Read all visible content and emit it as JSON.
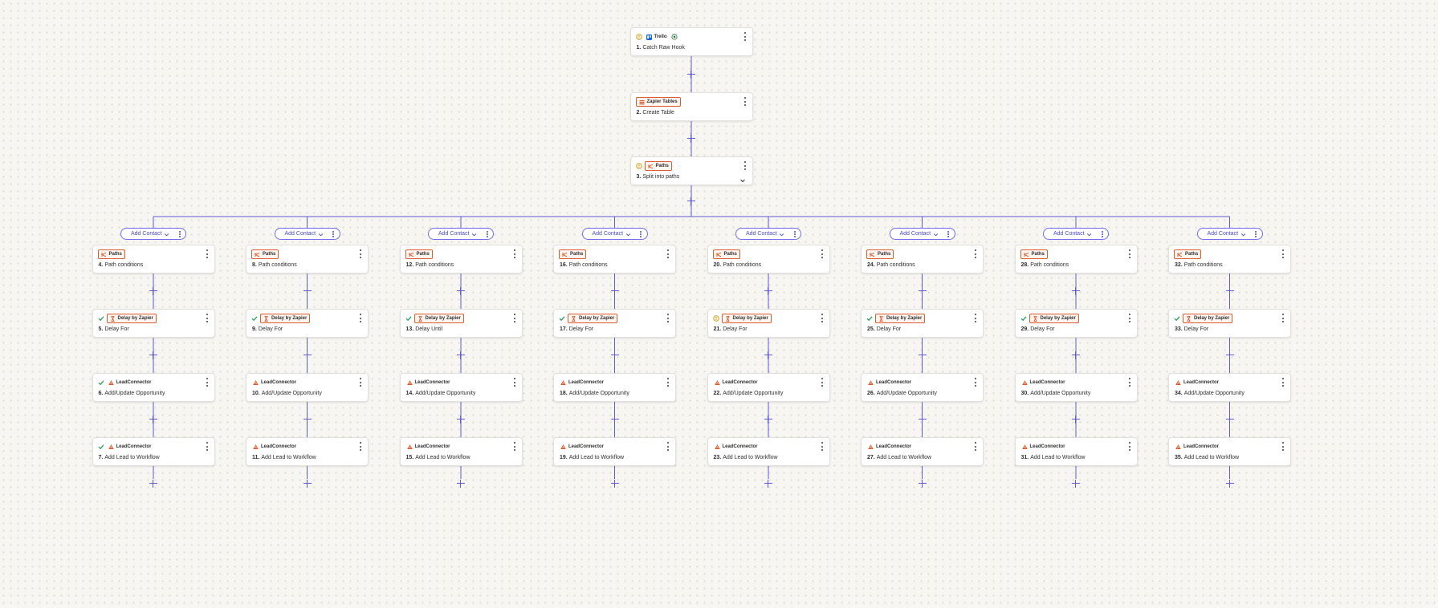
{
  "colors": {
    "accent": "#5d5bd4",
    "brand_orange": "#e0592a",
    "success": "#1f9d55",
    "warning": "#c79a18",
    "trello": "#0c66e4"
  },
  "top_steps": [
    {
      "num": "1.",
      "title": "Catch Raw Hook",
      "app": "Trello",
      "app_icon": "trello-icon",
      "badge_style": "plain",
      "status": "warning",
      "extra_icon": "settings-badge-icon",
      "chevron": false
    },
    {
      "num": "2.",
      "title": "Create Table",
      "app": "Zapier Tables",
      "app_icon": "zapier-tables-icon",
      "badge_style": "orange",
      "status": "none",
      "extra_icon": "",
      "chevron": false
    },
    {
      "num": "3.",
      "title": "Split into paths",
      "app": "Paths",
      "app_icon": "paths-icon",
      "badge_style": "orange",
      "status": "warning",
      "extra_icon": "",
      "chevron": true
    }
  ],
  "branches": [
    {
      "label": "Add Contact",
      "steps": [
        {
          "num": "4.",
          "title": "Path conditions",
          "app": "Paths",
          "status": "none"
        },
        {
          "num": "5.",
          "title": "Delay For",
          "app": "Delay by Zapier",
          "status": "success"
        },
        {
          "num": "6.",
          "title": "Add/Update Opportunity",
          "app": "LeadConnector",
          "status": "success"
        },
        {
          "num": "7.",
          "title": "Add Lead to Workflow",
          "app": "LeadConnector",
          "status": "success"
        }
      ]
    },
    {
      "label": "Add Contact",
      "steps": [
        {
          "num": "8.",
          "title": "Path conditions",
          "app": "Paths",
          "status": "none"
        },
        {
          "num": "9.",
          "title": "Delay For",
          "app": "Delay by Zapier",
          "status": "success"
        },
        {
          "num": "10.",
          "title": "Add/Update Opportunity",
          "app": "LeadConnector",
          "status": "none"
        },
        {
          "num": "11.",
          "title": "Add Lead to Workflow",
          "app": "LeadConnector",
          "status": "none"
        }
      ]
    },
    {
      "label": "Add Contact",
      "steps": [
        {
          "num": "12.",
          "title": "Path conditions",
          "app": "Paths",
          "status": "none"
        },
        {
          "num": "13.",
          "title": "Delay Until",
          "app": "Delay by Zapier",
          "status": "success"
        },
        {
          "num": "14.",
          "title": "Add/Update Opportunity",
          "app": "LeadConnector",
          "status": "none"
        },
        {
          "num": "15.",
          "title": "Add Lead to Workflow",
          "app": "LeadConnector",
          "status": "none"
        }
      ]
    },
    {
      "label": "Add Contact",
      "steps": [
        {
          "num": "16.",
          "title": "Path conditions",
          "app": "Paths",
          "status": "none"
        },
        {
          "num": "17.",
          "title": "Delay For",
          "app": "Delay by Zapier",
          "status": "success"
        },
        {
          "num": "18.",
          "title": "Add/Update Opportunity",
          "app": "LeadConnector",
          "status": "none"
        },
        {
          "num": "19.",
          "title": "Add Lead to Workflow",
          "app": "LeadConnector",
          "status": "none"
        }
      ]
    },
    {
      "label": "Add Contact",
      "steps": [
        {
          "num": "20.",
          "title": "Path conditions",
          "app": "Paths",
          "status": "none"
        },
        {
          "num": "21.",
          "title": "Delay For",
          "app": "Delay by Zapier",
          "status": "warning"
        },
        {
          "num": "22.",
          "title": "Add/Update Opportunity",
          "app": "LeadConnector",
          "status": "none"
        },
        {
          "num": "23.",
          "title": "Add Lead to Workflow",
          "app": "LeadConnector",
          "status": "none"
        }
      ]
    },
    {
      "label": "Add Contact",
      "steps": [
        {
          "num": "24.",
          "title": "Path conditions",
          "app": "Paths",
          "status": "none"
        },
        {
          "num": "25.",
          "title": "Delay For",
          "app": "Delay by Zapier",
          "status": "success"
        },
        {
          "num": "26.",
          "title": "Add/Update Opportunity",
          "app": "LeadConnector",
          "status": "none"
        },
        {
          "num": "27.",
          "title": "Add Lead to Workflow",
          "app": "LeadConnector",
          "status": "none"
        }
      ]
    },
    {
      "label": "Add Contact",
      "steps": [
        {
          "num": "28.",
          "title": "Path conditions",
          "app": "Paths",
          "status": "none"
        },
        {
          "num": "29.",
          "title": "Delay For",
          "app": "Delay by Zapier",
          "status": "success"
        },
        {
          "num": "30.",
          "title": "Add/Update Opportunity",
          "app": "LeadConnector",
          "status": "none"
        },
        {
          "num": "31.",
          "title": "Add Lead to Workflow",
          "app": "LeadConnector",
          "status": "none"
        }
      ]
    },
    {
      "label": "Add Contact",
      "steps": [
        {
          "num": "32.",
          "title": "Path conditions",
          "app": "Paths",
          "status": "none"
        },
        {
          "num": "33.",
          "title": "Delay For",
          "app": "Delay by Zapier",
          "status": "success"
        },
        {
          "num": "34.",
          "title": "Add/Update Opportunity",
          "app": "LeadConnector",
          "status": "none"
        },
        {
          "num": "35.",
          "title": "Add Lead to Workflow",
          "app": "LeadConnector",
          "status": "none"
        }
      ]
    }
  ]
}
